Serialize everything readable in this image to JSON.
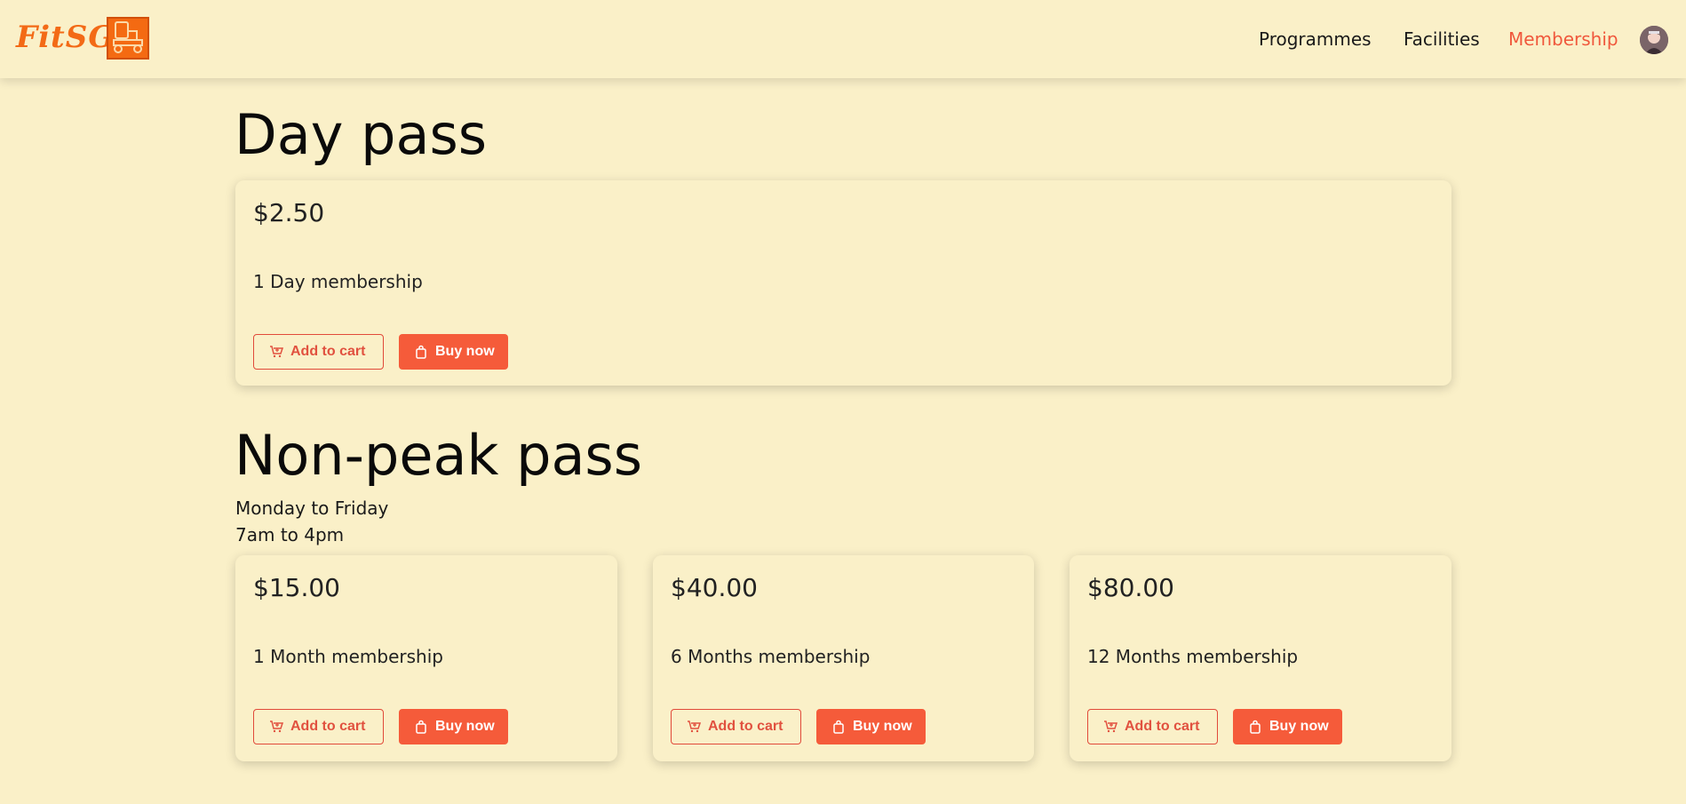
{
  "brand": {
    "name": "FitSG"
  },
  "nav": {
    "items": [
      {
        "label": "Programmes",
        "active": false
      },
      {
        "label": "Facilities",
        "active": false
      },
      {
        "label": "Membership",
        "active": true
      }
    ]
  },
  "sections": {
    "day_pass": {
      "title": "Day pass",
      "cards": [
        {
          "price": "$2.50",
          "description": "1 Day membership"
        }
      ]
    },
    "non_peak_pass": {
      "title": "Non-peak pass",
      "subtitle_lines": [
        "Monday to Friday",
        "7am to 4pm"
      ],
      "cards": [
        {
          "price": "$15.00",
          "description": "1 Month membership"
        },
        {
          "price": "$40.00",
          "description": "6 Months membership"
        },
        {
          "price": "$80.00",
          "description": "12 Months membership"
        }
      ]
    }
  },
  "buttons": {
    "add_to_cart": "Add to cart",
    "buy_now": "Buy now"
  },
  "icons": {
    "cart": "cart-icon",
    "bag": "shopping-bag-icon",
    "avatar": "avatar"
  },
  "colors": {
    "accent": "#f55b3a",
    "brand": "#f36a16",
    "background": "#faf0c8",
    "active_nav": "#f0583c"
  }
}
